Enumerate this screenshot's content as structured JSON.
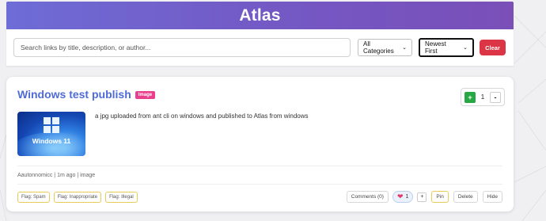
{
  "app": {
    "title": "Atlas"
  },
  "search": {
    "placeholder": "Search links by title, description, or author...",
    "category_selected": "All Categories",
    "sort_selected": "Newest First",
    "clear_label": "Clear"
  },
  "colors": {
    "header_gradient_start": "#6e6cd6",
    "header_gradient_end": "#7a4fb8",
    "title": "#4f6bd8",
    "badge": "#e8408c",
    "clear": "#dc3545",
    "upvote": "#28a745"
  },
  "post": {
    "title": "Windows test publish",
    "badge": "Image",
    "votes": {
      "up_label": "+",
      "count": "1",
      "down_label": "-"
    },
    "thumbnail_text": "Windows 11",
    "description": "a jpg uploaded from ant cli on windows and published to Atlas from windows",
    "meta": "Aautonnomicc | 1m ago | image",
    "flags": [
      "Flag: Spam",
      "Flag: Inappropriate",
      "Flag: Illegal"
    ],
    "comments_label": "Comments (0)",
    "reaction": {
      "icon": "heart-icon",
      "count": "1"
    },
    "add_reaction_label": "+",
    "pin_label": "Pin",
    "delete_label": "Delete",
    "hide_label": "Hide"
  }
}
